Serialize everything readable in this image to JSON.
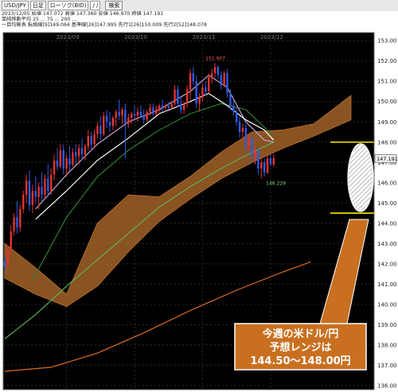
{
  "toolbar": {
    "symbol": "USD/JPY",
    "timeframe": "日足",
    "chart_type": "ローソク(BID)",
    "date_value": "/ /",
    "search_button": "検索"
  },
  "info": {
    "row1": "2023/12/05 始値 147.072  高値 147.360  安値 146.970  終値 147.191",
    "row2": "単純移動平均 25 ... 75 ... 200 ...",
    "row3": "一目均衡表 転換線[9]149.064 基準線[26]147.995 先行1[26]150.009 先行2[52]148.078"
  },
  "chart_data": {
    "type": "candlestick",
    "title": "",
    "xlabel": "",
    "ylabel": "",
    "ylim": [
      135.8,
      153.4
    ],
    "y_ticks": [
      "153.00",
      "152.00",
      "151.00",
      "150.00",
      "149.00",
      "148.00",
      "147.00",
      "146.00",
      "145.00",
      "144.00",
      "143.00",
      "142.00",
      "141.00",
      "140.00",
      "139.00",
      "138.00",
      "137.00",
      "136.00"
    ],
    "month_labels": [
      {
        "label": "2023/09",
        "index": 20
      },
      {
        "label": "2023/10",
        "index": 42
      },
      {
        "label": "2023/11",
        "index": 64
      },
      {
        "label": "2023/12",
        "index": 86
      }
    ],
    "x_count": 120,
    "candles": [
      {
        "o": 142.1,
        "h": 142.4,
        "l": 141.7,
        "c": 141.9
      },
      {
        "o": 141.9,
        "h": 142.9,
        "l": 141.8,
        "c": 142.7
      },
      {
        "o": 142.7,
        "h": 143.9,
        "l": 142.5,
        "c": 143.6
      },
      {
        "o": 143.6,
        "h": 144.5,
        "l": 143.4,
        "c": 144.3
      },
      {
        "o": 144.3,
        "h": 145.1,
        "l": 143.5,
        "c": 143.8
      },
      {
        "o": 143.8,
        "h": 144.9,
        "l": 143.6,
        "c": 144.7
      },
      {
        "o": 144.7,
        "h": 145.6,
        "l": 144.5,
        "c": 145.4
      },
      {
        "o": 145.4,
        "h": 146.4,
        "l": 145.0,
        "c": 146.1
      },
      {
        "o": 146.1,
        "h": 146.6,
        "l": 144.6,
        "c": 144.9
      },
      {
        "o": 144.9,
        "h": 145.9,
        "l": 144.5,
        "c": 145.6
      },
      {
        "o": 145.6,
        "h": 146.3,
        "l": 145.0,
        "c": 145.3
      },
      {
        "o": 145.3,
        "h": 146.0,
        "l": 144.7,
        "c": 145.8
      },
      {
        "o": 145.8,
        "h": 146.5,
        "l": 145.1,
        "c": 145.4
      },
      {
        "o": 145.4,
        "h": 146.4,
        "l": 145.2,
        "c": 146.2
      },
      {
        "o": 146.2,
        "h": 146.9,
        "l": 145.3,
        "c": 145.6
      },
      {
        "o": 145.6,
        "h": 146.7,
        "l": 145.4,
        "c": 146.4
      },
      {
        "o": 146.4,
        "h": 147.4,
        "l": 146.1,
        "c": 147.1
      },
      {
        "o": 147.1,
        "h": 147.7,
        "l": 146.6,
        "c": 146.8
      },
      {
        "o": 146.8,
        "h": 147.9,
        "l": 146.7,
        "c": 147.6
      },
      {
        "o": 147.6,
        "h": 147.9,
        "l": 146.4,
        "c": 146.7
      },
      {
        "o": 146.7,
        "h": 147.4,
        "l": 146.3,
        "c": 147.2
      },
      {
        "o": 147.2,
        "h": 147.8,
        "l": 146.6,
        "c": 146.9
      },
      {
        "o": 146.9,
        "h": 147.7,
        "l": 146.8,
        "c": 147.5
      },
      {
        "o": 147.5,
        "h": 147.9,
        "l": 146.9,
        "c": 147.3
      },
      {
        "o": 147.3,
        "h": 147.9,
        "l": 146.9,
        "c": 147.7
      },
      {
        "o": 147.7,
        "h": 148.2,
        "l": 147.1,
        "c": 147.4
      },
      {
        "o": 147.4,
        "h": 147.9,
        "l": 147.1,
        "c": 147.8
      },
      {
        "o": 147.8,
        "h": 148.6,
        "l": 147.6,
        "c": 148.3
      },
      {
        "o": 148.3,
        "h": 148.5,
        "l": 147.6,
        "c": 147.9
      },
      {
        "o": 147.9,
        "h": 148.6,
        "l": 147.7,
        "c": 148.4
      },
      {
        "o": 148.4,
        "h": 149.0,
        "l": 148.2,
        "c": 148.8
      },
      {
        "o": 148.8,
        "h": 149.3,
        "l": 148.1,
        "c": 148.4
      },
      {
        "o": 148.4,
        "h": 149.5,
        "l": 148.3,
        "c": 149.3
      },
      {
        "o": 149.3,
        "h": 149.6,
        "l": 148.7,
        "c": 149.0
      },
      {
        "o": 149.0,
        "h": 149.5,
        "l": 148.5,
        "c": 148.8
      },
      {
        "o": 148.8,
        "h": 149.3,
        "l": 148.6,
        "c": 149.2
      },
      {
        "o": 149.2,
        "h": 149.6,
        "l": 148.8,
        "c": 149.5
      },
      {
        "o": 149.5,
        "h": 150.1,
        "l": 149.1,
        "c": 149.3
      },
      {
        "o": 149.3,
        "h": 149.7,
        "l": 148.9,
        "c": 149.6
      },
      {
        "o": 149.6,
        "h": 149.9,
        "l": 147.2,
        "c": 148.9
      },
      {
        "o": 148.9,
        "h": 149.4,
        "l": 148.7,
        "c": 149.2
      },
      {
        "o": 149.2,
        "h": 149.5,
        "l": 148.9,
        "c": 149.4
      },
      {
        "o": 149.4,
        "h": 149.8,
        "l": 149.1,
        "c": 149.3
      },
      {
        "o": 149.3,
        "h": 149.7,
        "l": 149.0,
        "c": 149.5
      },
      {
        "o": 149.5,
        "h": 149.8,
        "l": 149.2,
        "c": 149.3
      },
      {
        "o": 149.3,
        "h": 149.6,
        "l": 148.9,
        "c": 149.1
      },
      {
        "o": 149.1,
        "h": 149.6,
        "l": 149.0,
        "c": 149.5
      },
      {
        "o": 149.5,
        "h": 149.9,
        "l": 149.3,
        "c": 149.7
      },
      {
        "o": 149.7,
        "h": 149.9,
        "l": 149.3,
        "c": 149.4
      },
      {
        "o": 149.4,
        "h": 149.8,
        "l": 149.3,
        "c": 149.6
      },
      {
        "o": 149.6,
        "h": 149.9,
        "l": 149.4,
        "c": 149.8
      },
      {
        "o": 149.8,
        "h": 150.1,
        "l": 149.5,
        "c": 149.7
      },
      {
        "o": 149.7,
        "h": 149.9,
        "l": 149.5,
        "c": 149.8
      },
      {
        "o": 149.8,
        "h": 150.0,
        "l": 149.6,
        "c": 149.7
      },
      {
        "o": 149.7,
        "h": 150.0,
        "l": 149.6,
        "c": 149.9
      },
      {
        "o": 149.9,
        "h": 150.8,
        "l": 149.8,
        "c": 150.6
      },
      {
        "o": 150.6,
        "h": 150.8,
        "l": 149.7,
        "c": 149.9
      },
      {
        "o": 149.9,
        "h": 150.2,
        "l": 149.4,
        "c": 149.6
      },
      {
        "o": 149.6,
        "h": 150.0,
        "l": 149.4,
        "c": 149.9
      },
      {
        "o": 149.9,
        "h": 150.8,
        "l": 149.7,
        "c": 150.6
      },
      {
        "o": 150.6,
        "h": 151.6,
        "l": 150.1,
        "c": 151.4
      },
      {
        "o": 151.4,
        "h": 151.7,
        "l": 150.8,
        "c": 151.0
      },
      {
        "o": 151.0,
        "h": 151.3,
        "l": 149.7,
        "c": 149.9
      },
      {
        "o": 149.9,
        "h": 150.4,
        "l": 149.5,
        "c": 150.2
      },
      {
        "o": 150.2,
        "h": 150.9,
        "l": 150.0,
        "c": 150.7
      },
      {
        "o": 150.7,
        "h": 151.0,
        "l": 150.3,
        "c": 150.5
      },
      {
        "o": 150.5,
        "h": 151.4,
        "l": 150.4,
        "c": 151.2
      },
      {
        "o": 151.2,
        "h": 151.6,
        "l": 150.9,
        "c": 151.4
      },
      {
        "o": 151.4,
        "h": 151.9,
        "l": 151.2,
        "c": 151.7
      },
      {
        "o": 151.7,
        "h": 151.8,
        "l": 151.1,
        "c": 151.3
      },
      {
        "o": 151.3,
        "h": 151.5,
        "l": 150.6,
        "c": 150.8
      },
      {
        "o": 150.8,
        "h": 151.5,
        "l": 150.7,
        "c": 151.4
      },
      {
        "o": 151.4,
        "h": 151.6,
        "l": 150.2,
        "c": 150.4
      },
      {
        "o": 150.4,
        "h": 150.6,
        "l": 149.6,
        "c": 149.8
      },
      {
        "o": 149.8,
        "h": 150.1,
        "l": 149.3,
        "c": 149.5
      },
      {
        "o": 149.5,
        "h": 149.7,
        "l": 148.8,
        "c": 149.0
      },
      {
        "o": 149.0,
        "h": 149.3,
        "l": 148.2,
        "c": 148.5
      },
      {
        "o": 148.5,
        "h": 148.9,
        "l": 148.0,
        "c": 148.7
      },
      {
        "o": 148.7,
        "h": 148.9,
        "l": 147.5,
        "c": 147.8
      },
      {
        "o": 147.8,
        "h": 148.4,
        "l": 147.6,
        "c": 148.2
      },
      {
        "o": 148.2,
        "h": 148.3,
        "l": 147.0,
        "c": 147.3
      },
      {
        "o": 147.3,
        "h": 147.8,
        "l": 146.9,
        "c": 147.6
      },
      {
        "o": 147.6,
        "h": 147.7,
        "l": 146.4,
        "c": 146.7
      },
      {
        "o": 146.7,
        "h": 147.2,
        "l": 146.2,
        "c": 147.0
      },
      {
        "o": 147.0,
        "h": 147.2,
        "l": 146.3,
        "c": 146.5
      },
      {
        "o": 146.5,
        "h": 147.4,
        "l": 146.4,
        "c": 147.2
      },
      {
        "o": 147.2,
        "h": 147.4,
        "l": 146.8,
        "c": 146.9
      },
      {
        "o": 146.9,
        "h": 147.4,
        "l": 146.8,
        "c": 147.19
      }
    ],
    "annotations": {
      "high_label": "151.907",
      "low_label": "146.229",
      "current_price": "147.191",
      "forecast_text_line1": "今週の米ドル/円",
      "forecast_text_line2": "予想レンジは",
      "forecast_text_line3": "144.50〜148.00円",
      "range_high": 148.0,
      "range_low": 144.5
    },
    "series": [
      {
        "name": "ma25",
        "color": "#2f7d32",
        "points": [
          [
            9,
            141.2
          ],
          [
            20,
            144.3
          ],
          [
            30,
            146.3
          ],
          [
            40,
            147.6
          ],
          [
            50,
            148.6
          ],
          [
            60,
            149.4
          ],
          [
            70,
            149.9
          ],
          [
            78,
            149.6
          ],
          [
            87,
            148.3
          ]
        ]
      },
      {
        "name": "ma75",
        "color": "#5fb05f",
        "points": [
          [
            0,
            138.3
          ],
          [
            10,
            139.5
          ],
          [
            20,
            140.9
          ],
          [
            30,
            142.2
          ],
          [
            40,
            143.5
          ],
          [
            50,
            144.8
          ],
          [
            60,
            145.8
          ],
          [
            70,
            146.7
          ],
          [
            80,
            147.5
          ],
          [
            87,
            148.0
          ]
        ]
      },
      {
        "name": "ma200",
        "color": "#e06c1e",
        "points": [
          [
            0,
            136.7
          ],
          [
            15,
            136.9
          ],
          [
            30,
            137.6
          ],
          [
            45,
            138.6
          ],
          [
            60,
            139.7
          ],
          [
            75,
            140.7
          ],
          [
            90,
            141.6
          ],
          [
            99,
            142.1
          ]
        ]
      },
      {
        "name": "tenkan",
        "color": "#c8a2d8",
        "points": [
          [
            10,
            144.7
          ],
          [
            20,
            146.4
          ],
          [
            30,
            147.9
          ],
          [
            40,
            149.0
          ],
          [
            50,
            149.6
          ],
          [
            60,
            150.5
          ],
          [
            66,
            151.3
          ],
          [
            72,
            150.7
          ],
          [
            78,
            149.0
          ],
          [
            84,
            148.1
          ],
          [
            87,
            148.0
          ]
        ]
      },
      {
        "name": "kijun",
        "color": "#ffffff",
        "points": [
          [
            10,
            144.2
          ],
          [
            20,
            145.6
          ],
          [
            30,
            147.1
          ],
          [
            40,
            148.2
          ],
          [
            50,
            149.4
          ],
          [
            60,
            150.0
          ],
          [
            66,
            150.4
          ],
          [
            72,
            149.8
          ],
          [
            78,
            149.1
          ],
          [
            84,
            148.6
          ],
          [
            87,
            148.1
          ]
        ]
      }
    ],
    "cloud": {
      "span_a": [
        [
          0,
          143.0
        ],
        [
          10,
          141.8
        ],
        [
          20,
          140.5
        ],
        [
          30,
          144.0
        ],
        [
          40,
          145.4
        ],
        [
          50,
          145.3
        ],
        [
          60,
          146.3
        ],
        [
          70,
          147.5
        ],
        [
          80,
          148.5
        ],
        [
          90,
          148.6
        ],
        [
          100,
          148.9
        ],
        [
          112,
          150.3
        ]
      ],
      "span_b": [
        [
          0,
          141.3
        ],
        [
          10,
          140.5
        ],
        [
          20,
          139.9
        ],
        [
          30,
          140.9
        ],
        [
          40,
          142.6
        ],
        [
          50,
          144.1
        ],
        [
          60,
          145.2
        ],
        [
          70,
          146.2
        ],
        [
          80,
          147.0
        ],
        [
          90,
          147.7
        ],
        [
          100,
          148.3
        ],
        [
          112,
          149.1
        ]
      ],
      "color": "#b06a2c",
      "fill": "rgba(176,106,44,0.78)"
    },
    "legend_position": "top-left",
    "grid": true
  }
}
